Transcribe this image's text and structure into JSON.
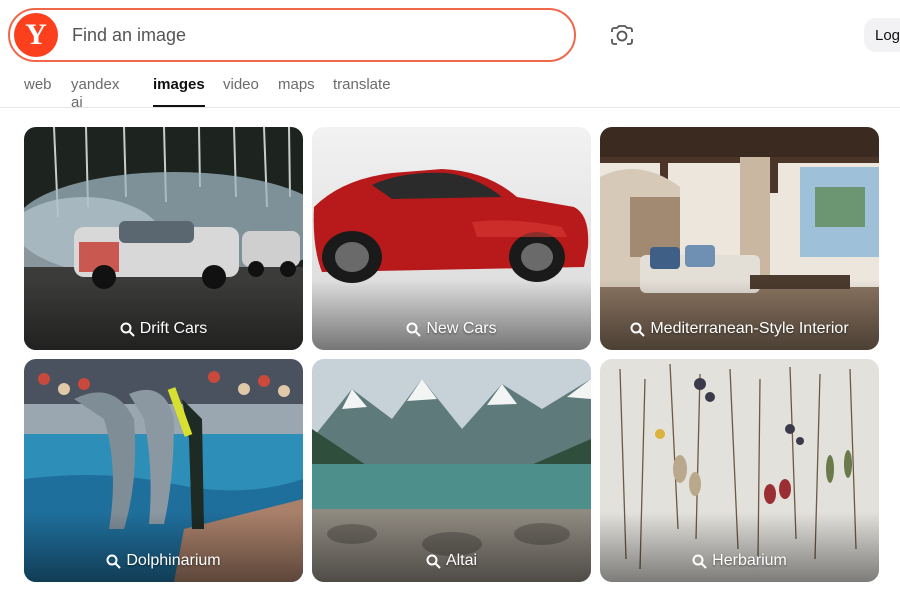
{
  "header": {
    "logo_letter": "Y",
    "search_placeholder": "Find an image",
    "camera_icon": "camera-search-icon",
    "login_label": "Log"
  },
  "tabs": [
    {
      "label": "web",
      "active": false
    },
    {
      "label": "yandex ai",
      "active": false
    },
    {
      "label": "images",
      "active": true
    },
    {
      "label": "video",
      "active": false
    },
    {
      "label": "maps",
      "active": false
    },
    {
      "label": "translate",
      "active": false
    }
  ],
  "cards": [
    {
      "label": "Drift Cars",
      "icon": "search-icon"
    },
    {
      "label": "New Cars",
      "icon": "search-icon"
    },
    {
      "label": "Mediterranean-Style Interior",
      "icon": "search-icon"
    },
    {
      "label": "Dolphinarium",
      "icon": "search-icon"
    },
    {
      "label": "Altai",
      "icon": "search-icon"
    },
    {
      "label": "Herbarium",
      "icon": "search-icon"
    }
  ],
  "colors": {
    "accent": "#fc3f1d",
    "search_border": "#f0684b"
  }
}
